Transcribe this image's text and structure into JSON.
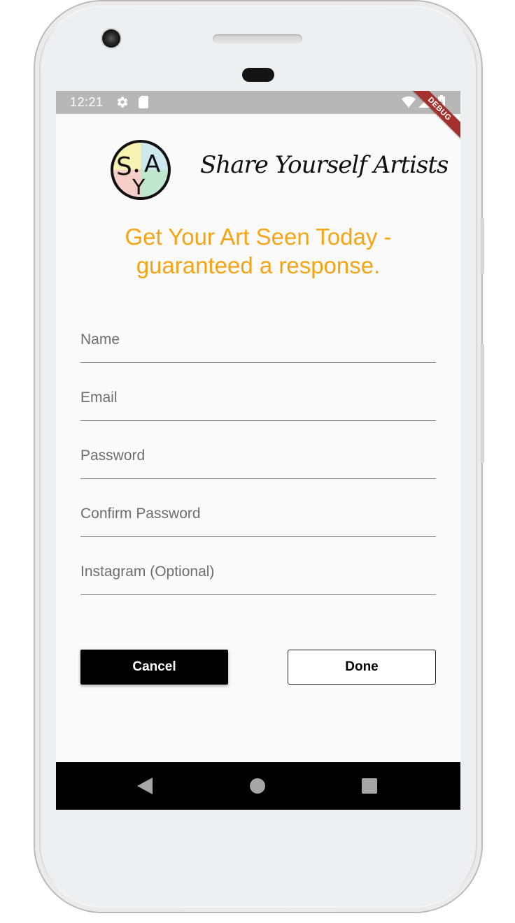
{
  "status_bar": {
    "time": "12:21",
    "debug_label": "DEBUG",
    "icons": [
      "gear-icon",
      "sd-card-icon",
      "wifi-icon",
      "signal-icon",
      "battery-charging-icon"
    ]
  },
  "header": {
    "logo_name": "sya-logo",
    "logo_letters": "SYA",
    "brand_name": "Share Yourself Artists"
  },
  "tagline": {
    "line1": "Get Your Art Seen Today -",
    "line2": "guaranteed a response."
  },
  "form": {
    "fields": [
      {
        "placeholder": "Name",
        "value": ""
      },
      {
        "placeholder": "Email",
        "value": ""
      },
      {
        "placeholder": "Password",
        "value": ""
      },
      {
        "placeholder": "Confirm Password",
        "value": ""
      },
      {
        "placeholder": "Instagram (Optional)",
        "value": ""
      }
    ]
  },
  "buttons": {
    "cancel_label": "Cancel",
    "done_label": "Done"
  },
  "nav_bar": {
    "icons": [
      "back-icon",
      "home-icon",
      "recent-apps-icon"
    ]
  },
  "colors": {
    "tagline": "#f5a414",
    "debug_ribbon": "#a3322e",
    "status_bar": "#b7b7b7",
    "screen_background": "#fafafa",
    "cancel_button": "#000000",
    "logo_yellow": "#f7f3b3",
    "logo_pink": "#f6cfc8",
    "logo_green": "#bfe8cf",
    "logo_blue": "#cde9ee"
  }
}
